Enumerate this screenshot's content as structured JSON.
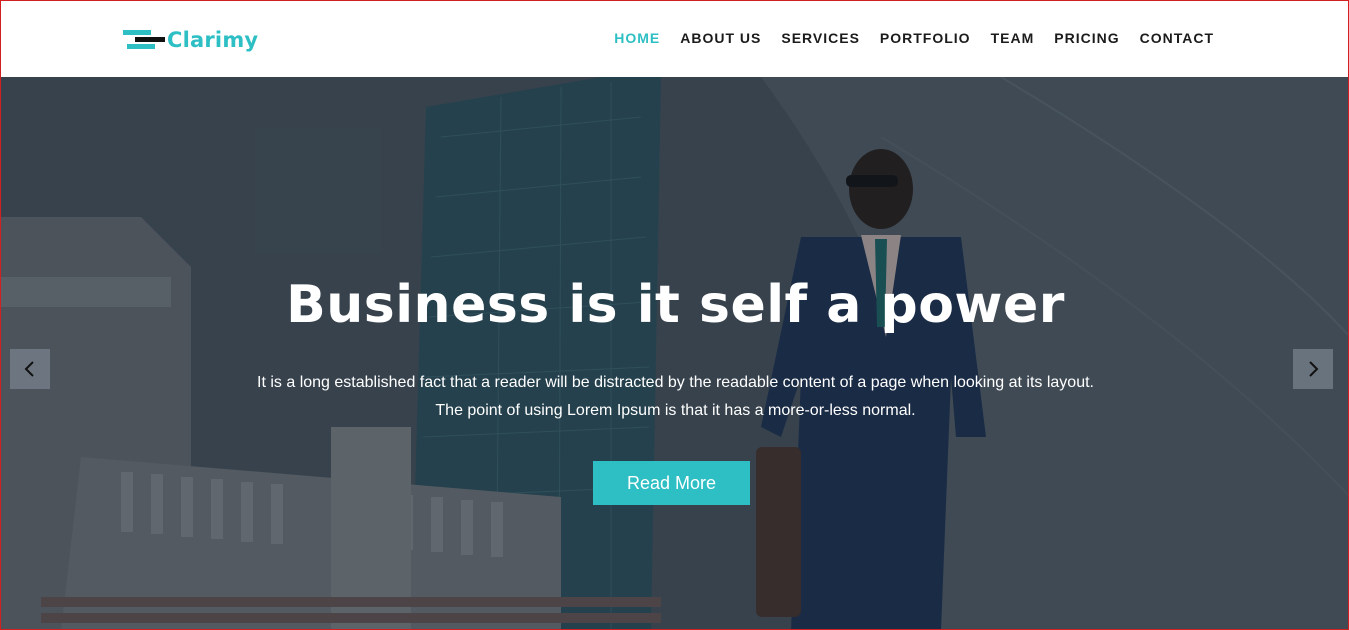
{
  "brand": {
    "name": "Clarimy",
    "accent_color": "#2dbfc4",
    "logo_icon": "stacked-bars-logo-icon"
  },
  "nav": {
    "items": [
      {
        "label": "HOME",
        "active": true
      },
      {
        "label": "ABOUT US",
        "active": false
      },
      {
        "label": "SERVICES",
        "active": false
      },
      {
        "label": "PORTFOLIO",
        "active": false
      },
      {
        "label": "TEAM",
        "active": false
      },
      {
        "label": "PRICING",
        "active": false
      },
      {
        "label": "CONTACT",
        "active": false
      }
    ]
  },
  "hero": {
    "title": "Business is it self a power",
    "text_line1": "It is a long established fact that a reader will be distracted by the readable content of a page when looking at its layout.",
    "text_line2": "The point of using Lorem Ipsum is that it has a more-or-less normal.",
    "button_label": "Read More",
    "prev_icon": "chevron-left-icon",
    "next_icon": "chevron-right-icon"
  }
}
